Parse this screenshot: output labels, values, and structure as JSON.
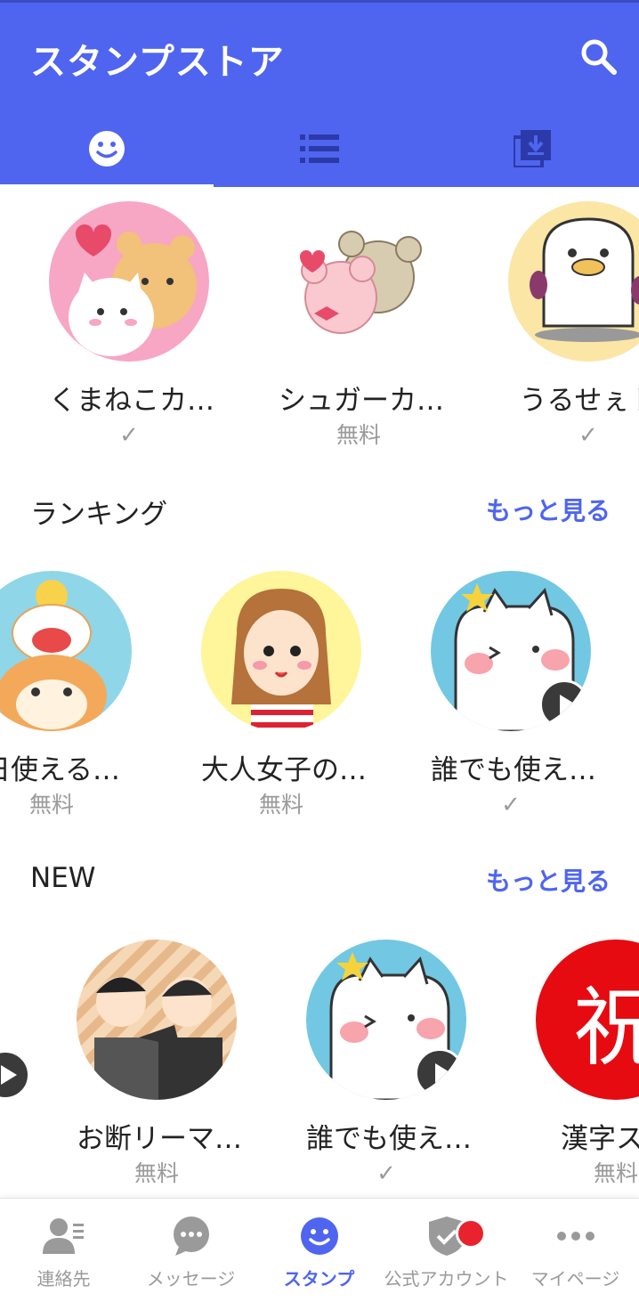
{
  "header": {
    "title": "スタンプストア"
  },
  "tabs": [
    {
      "icon": "smiley-icon"
    },
    {
      "icon": "list-icon"
    },
    {
      "icon": "download-library-icon"
    }
  ],
  "featured": [
    {
      "name": "くまねこカ…",
      "status": "✓"
    },
    {
      "name": "シュガーカ…",
      "status": "無料"
    },
    {
      "name": "うるせぇト",
      "status": "✓"
    }
  ],
  "ranking": {
    "title": "ランキング",
    "more": "もっと見る",
    "items": [
      {
        "name": "日使える…",
        "status": "無料"
      },
      {
        "name": "大人女子の…",
        "status": "無料"
      },
      {
        "name": "誰でも使え…",
        "status": "✓"
      }
    ]
  },
  "new": {
    "title": "NEW",
    "more": "もっと見る",
    "items": [
      {
        "name": "お断リーマ…",
        "status": "無料"
      },
      {
        "name": "誰でも使え…",
        "status": "✓"
      },
      {
        "name": "漢字スタ",
        "status": "無料",
        "glyph": "祝"
      }
    ]
  },
  "bottom_nav": [
    {
      "label": "連絡先",
      "icon": "contacts-icon"
    },
    {
      "label": "メッセージ",
      "icon": "chat-bubble-icon"
    },
    {
      "label": "スタンプ",
      "icon": "smiley-icon",
      "active": true
    },
    {
      "label": "公式アカウント",
      "icon": "shield-check-icon"
    },
    {
      "label": "マイページ",
      "icon": "more-dots-icon"
    }
  ],
  "colors": {
    "accent": "#4f65ef",
    "notification": "#e8232d"
  }
}
